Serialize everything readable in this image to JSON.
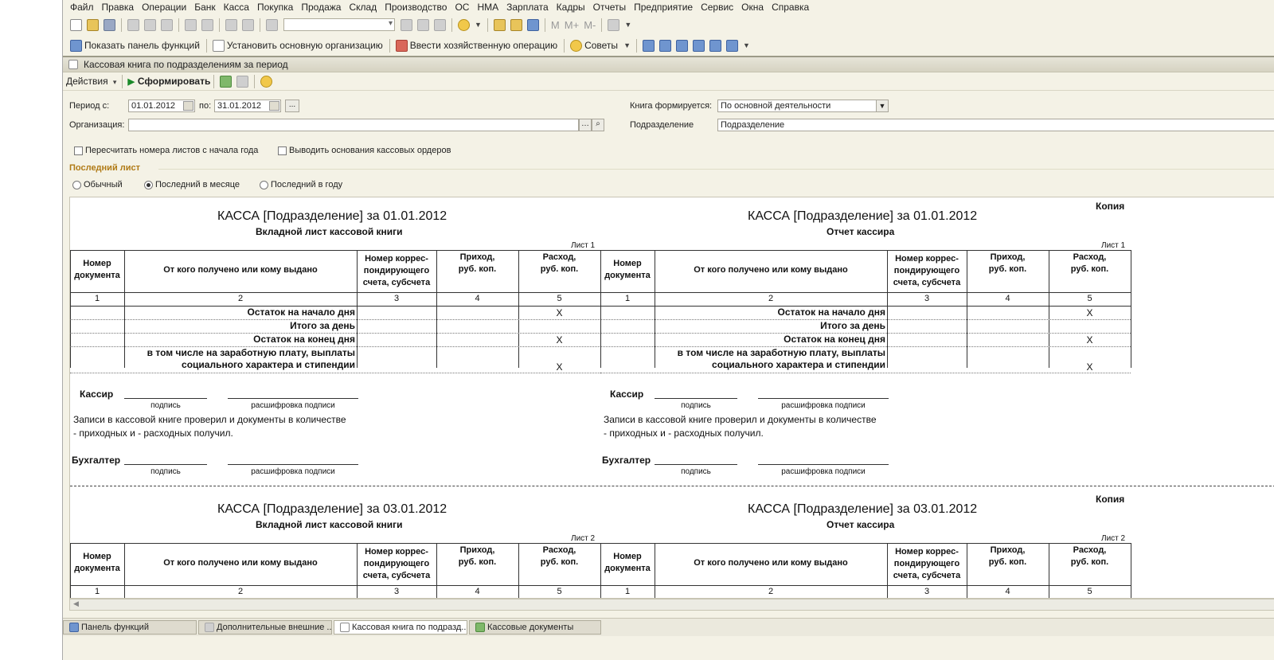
{
  "menu": [
    "Файл",
    "Правка",
    "Операции",
    "Банк",
    "Касса",
    "Покупка",
    "Продажа",
    "Склад",
    "Производство",
    "ОС",
    "НМА",
    "Зарплата",
    "Кадры",
    "Отчеты",
    "Предприятие",
    "Сервис",
    "Окна",
    "Справка"
  ],
  "toolbar2": {
    "show_panel": "Показать панель функций",
    "set_org": "Установить основную организацию",
    "enter_op": "Ввести хозяйственную операцию",
    "tips": "Советы"
  },
  "toolbar_mtext": [
    "M",
    "M+",
    "M-"
  ],
  "window": {
    "title": "Кассовая книга по подразделениям за период",
    "actions": "Действия",
    "generate": "Сформировать"
  },
  "form": {
    "period_from_label": "Период с:",
    "period_from": "01.01.2012",
    "period_to_label": "по:",
    "period_to": "31.01.2012",
    "ellipsis": "...",
    "org_label": "Организация:",
    "org_value": "",
    "book_label": "Книга формируется:",
    "book_value": "По основной деятельности",
    "div_label": "Подразделение",
    "div_value": "Подразделение",
    "chk_recount": "Пересчитать номера листов с начала года",
    "chk_basis": "Выводить основания кассовых ордеров",
    "last_sheet_title": "Последний лист",
    "radio_normal": "Обычный",
    "radio_month": "Последний в месяце",
    "radio_year": "Последний в году"
  },
  "report": {
    "copy_label": "Копия",
    "blocks": [
      {
        "title": "КАССА [Подразделение] за 01.01.2012",
        "sheet": "Лист 1"
      },
      {
        "title": "КАССА [Подразделение] за 03.01.2012",
        "sheet": "Лист 2"
      }
    ],
    "left_subtitle": "Вкладной лист кассовой книги",
    "right_subtitle": "Отчет кассира",
    "col_docnum": [
      "Номер",
      "документа"
    ],
    "col_from": "От кого получено или кому выдано",
    "col_account": [
      "Номер коррес-",
      "пондирующего",
      "счета, субсчета"
    ],
    "col_income": [
      "Приход,",
      "руб. коп."
    ],
    "col_expense": [
      "Расход,",
      "руб. коп."
    ],
    "col_nums": [
      "1",
      "2",
      "3",
      "4",
      "5"
    ],
    "row_start": "Остаток на начало дня",
    "row_total": "Итого за день",
    "row_end": "Остаток на конец  дня",
    "row_salary": [
      "в том числе на заработную плату, выплаты",
      "социального характера и стипендии"
    ],
    "x_mark": "X",
    "cashier": "Кассир",
    "sign": "подпись",
    "sign_decode": "расшифровка подписи",
    "checked_line1": "Записи в кассовой книге проверил и документы в количестве",
    "checked_line2": " - приходных и  - расходных получил.",
    "accountant": "Бухгалтер"
  },
  "taskbar": [
    "Панель функций",
    "Дополнительные внешние ...",
    "Кассовая книга по подразд...",
    "Кассовые документы"
  ]
}
